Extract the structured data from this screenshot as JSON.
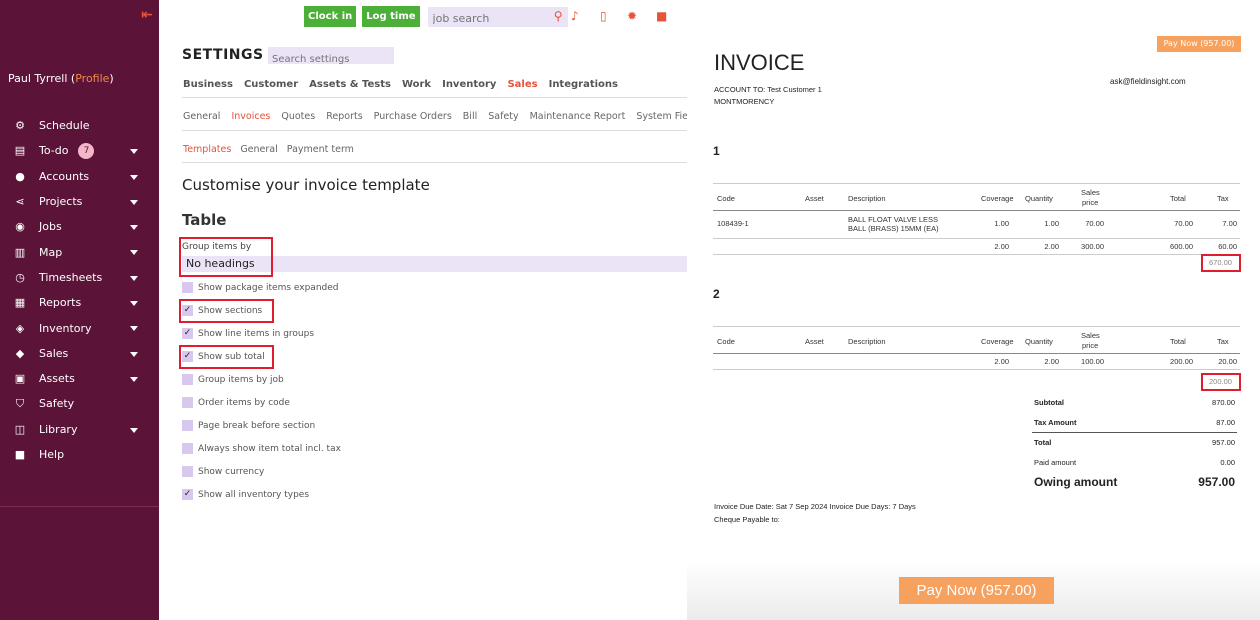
{
  "sidebar": {
    "user_name": "Paul Tyrrell",
    "profile_label": "Profile",
    "todo_count": "7",
    "items": [
      {
        "label": "Schedule"
      },
      {
        "label": "To-do"
      },
      {
        "label": "Accounts"
      },
      {
        "label": "Projects"
      },
      {
        "label": "Jobs"
      },
      {
        "label": "Map"
      },
      {
        "label": "Timesheets"
      },
      {
        "label": "Reports"
      },
      {
        "label": "Inventory"
      },
      {
        "label": "Sales"
      },
      {
        "label": "Assets"
      },
      {
        "label": "Safety"
      },
      {
        "label": "Library"
      },
      {
        "label": "Help"
      }
    ]
  },
  "topbar": {
    "clock_in": "Clock in",
    "log_time": "Log time",
    "job_search_placeholder": "job search"
  },
  "settings": {
    "title": "SETTINGS",
    "search_placeholder": "Search settings",
    "tabs_main": [
      "Business",
      "Customer",
      "Assets & Tests",
      "Work",
      "Inventory",
      "Sales",
      "Integrations"
    ],
    "tabs_sales": [
      "General",
      "Invoices",
      "Quotes",
      "Reports",
      "Purchase Orders",
      "Bill",
      "Safety",
      "Maintenance Report",
      "System Fields"
    ],
    "tabs_invoices": [
      "Templates",
      "General",
      "Payment term"
    ],
    "heading": "Customise your invoice template",
    "table_heading": "Table",
    "group_label": "Group items by",
    "group_value": "No headings",
    "options": [
      {
        "label": "Show package items expanded",
        "checked": false
      },
      {
        "label": "Show sections",
        "checked": true
      },
      {
        "label": "Show line items in groups",
        "checked": true
      },
      {
        "label": "Show sub total",
        "checked": true
      },
      {
        "label": "Group items by job",
        "checked": false
      },
      {
        "label": "Order items by code",
        "checked": false
      },
      {
        "label": "Page break before section",
        "checked": false
      },
      {
        "label": "Always show item total incl. tax",
        "checked": false
      },
      {
        "label": "Show currency",
        "checked": false
      },
      {
        "label": "Show all inventory types",
        "checked": true
      }
    ]
  },
  "invoice": {
    "pay_now_top": "Pay Now (957.00)",
    "title": "INVOICE",
    "account_line1": "ACCOUNT TO: Test Customer 1",
    "account_line2": "MONTMORENCY",
    "email": "ask@fieldinsight.com",
    "headers": {
      "code": "Code",
      "asset": "Asset",
      "description": "Description",
      "coverage": "Coverage",
      "quantity": "Quantity",
      "sales_price_1": "Sales",
      "sales_price_2": "price",
      "total": "Total",
      "tax": "Tax"
    },
    "sections": [
      {
        "number": "1",
        "rows": [
          {
            "code": "108439-1",
            "asset": "",
            "description_1": "BALL FLOAT VALVE LESS",
            "description_2": "BALL (BRASS)  15MM (EA)",
            "coverage": "1.00",
            "quantity": "1.00",
            "sales_price": "70.00",
            "total": "70.00",
            "tax": "7.00"
          },
          {
            "code": "",
            "asset": "",
            "description_1": "",
            "description_2": "",
            "coverage": "2.00",
            "quantity": "2.00",
            "sales_price": "300.00",
            "total": "600.00",
            "tax": "60.00"
          }
        ],
        "subtotal": "670.00"
      },
      {
        "number": "2",
        "rows": [
          {
            "code": "",
            "asset": "",
            "description_1": "",
            "description_2": "",
            "coverage": "2.00",
            "quantity": "2.00",
            "sales_price": "100.00",
            "total": "200.00",
            "tax": "20.00"
          }
        ],
        "subtotal": "200.00"
      }
    ],
    "summary": {
      "subtotal_label": "Subtotal",
      "subtotal": "870.00",
      "tax_label": "Tax Amount",
      "tax": "87.00",
      "total_label": "Total",
      "total": "957.00",
      "paid_label": "Paid amount",
      "paid": "0.00",
      "owing_label": "Owing amount",
      "owing": "957.00"
    },
    "footer_line1": "Invoice Due Date: Sat 7 Sep 2024 Invoice Due Days: 7 Days",
    "footer_line2": "Cheque Payable to:",
    "pay_now_bottom": "Pay Now (957.00)"
  },
  "colors": {
    "sidebar_bg": "#5b1437",
    "accent_orange": "#e6533a",
    "button_green": "#4caf38",
    "highlight_red": "#e01d2f",
    "pay_now": "#f7a15f"
  }
}
